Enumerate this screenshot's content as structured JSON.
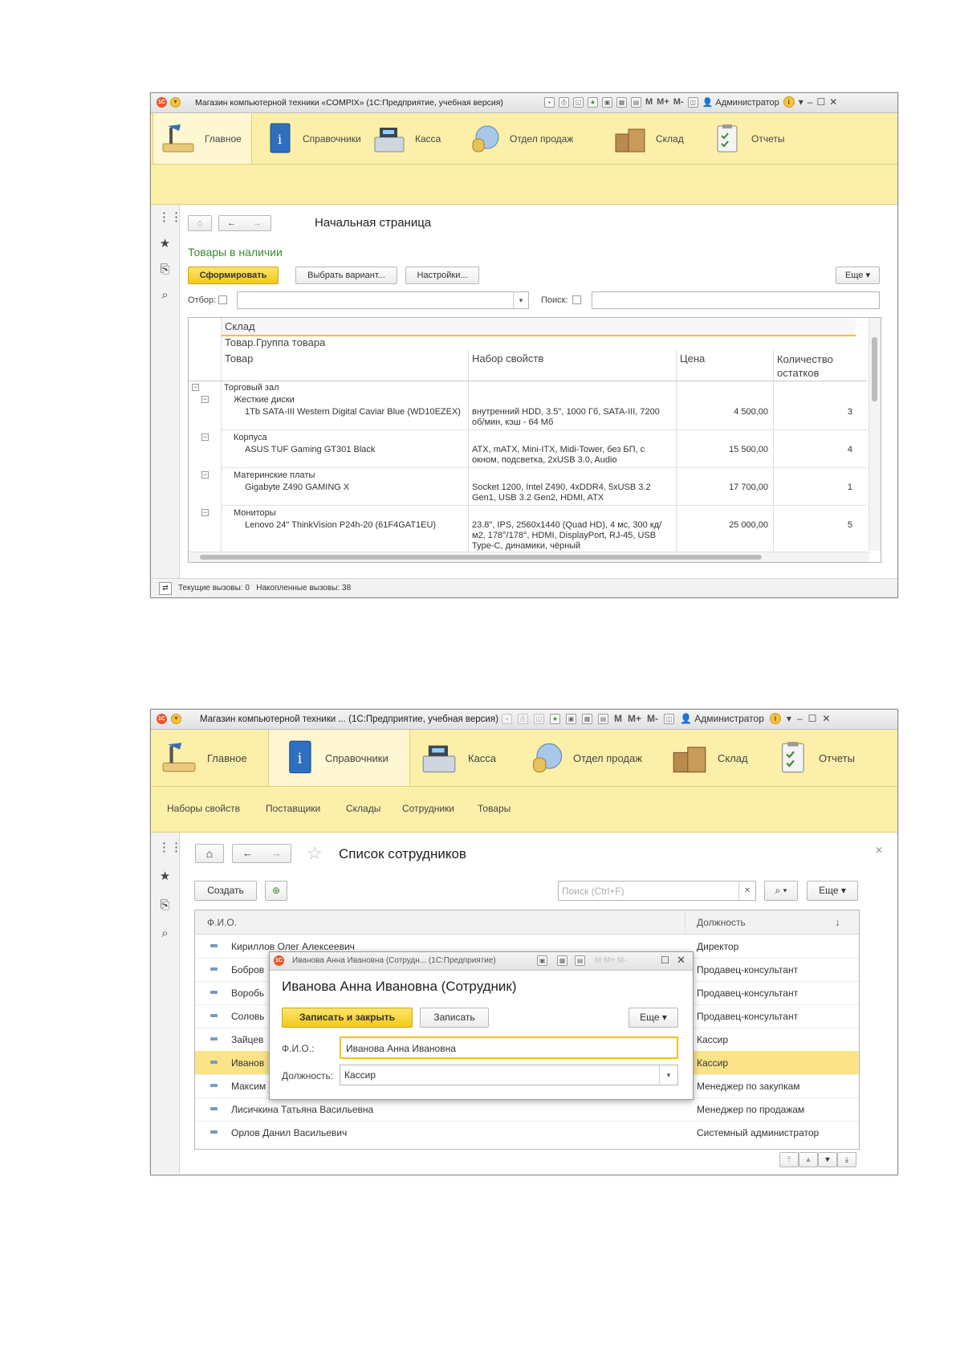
{
  "window1": {
    "title": "Магазин компьютерной техники «COMPIX» (1С:Предприятие, учебная версия)",
    "title_icons": [
      "save-icon",
      "print-icon",
      "preview-icon",
      "favorite-icon",
      "bookmark-icon",
      "calc-icon",
      "calendar-icon"
    ],
    "memory_buttons": [
      "M",
      "M+",
      "M-"
    ],
    "user": "Администратор",
    "sections": [
      "Главное",
      "Справочники",
      "Касса",
      "Отдел продаж",
      "Склад",
      "Отчеты"
    ],
    "active_section": "Главное",
    "page_title": "Начальная страница",
    "report_title": "Товары в наличии",
    "buttons": {
      "generate": "Сформировать",
      "choose_variant": "Выбрать вариант...",
      "settings": "Настройки...",
      "more": "Еще"
    },
    "filter_label": "Отбор:",
    "search_label": "Поиск:",
    "report_headers": {
      "row1": "Склад",
      "row2": "Товар.Группа товара",
      "product": "Товар",
      "properties": "Набор свойств",
      "price": "Цена",
      "quantity": "Количество остатков"
    },
    "warehouse": "Торговый зал",
    "groups": [
      {
        "name": "Жесткие диски",
        "item": "1Tb SATA-III Western Digital Caviar Blue (WD10EZEX)",
        "props": "внутренний HDD, 3.5\", 1000 Гб, SATA-III, 7200 об/мин, кэш - 64 Мб",
        "price": "4 500,00",
        "qty": "3"
      },
      {
        "name": "Корпуса",
        "item": "ASUS TUF Gaming GT301 Black",
        "props": "ATX, mATX, Mini-ITX, Midi-Tower, без БП, с окном, подсветка, 2xUSB 3.0, Audio",
        "price": "15 500,00",
        "qty": "4"
      },
      {
        "name": "Материнские платы",
        "item": "Gigabyte Z490 GAMING X",
        "props": "Socket 1200, Intel Z490, 4xDDR4, 5xUSB 3.2 Gen1, USB 3.2 Gen2, HDMI, ATX",
        "price": "17 700,00",
        "qty": "1"
      },
      {
        "name": "Мониторы",
        "item": "Lenovo 24\" ThinkVision P24h-20 (61F4GAT1EU)",
        "props": "23.8\", IPS, 2560x1440 (Quad HD), 4 мс, 300 кд/м2, 178°/178°, HDMI, DisplayPort, RJ-45, USB Type-C, динамики, чёрный",
        "price": "25 000,00",
        "qty": "5"
      }
    ],
    "status": "Текущие вызовы: 0   Накопленные вызовы: 38"
  },
  "window2": {
    "title": "Магазин компьютерной техники ... (1С:Предприятие, учебная версия)",
    "memory_buttons": [
      "M",
      "M+",
      "M-"
    ],
    "user": "Администратор",
    "sections": [
      "Главное",
      "Справочники",
      "Касса",
      "Отдел продаж",
      "Склад",
      "Отчеты"
    ],
    "active_section": "Справочники",
    "subsections": [
      "Наборы свойств",
      "Поставщики",
      "Склады",
      "Сотрудники",
      "Товары"
    ],
    "page_title": "Список сотрудников",
    "buttons": {
      "create": "Создать",
      "more": "Еще"
    },
    "search_placeholder": "Поиск (Ctrl+F)",
    "columns": {
      "name": "Ф.И.О.",
      "position": "Должность",
      "sort": "↓"
    },
    "rows": [
      {
        "name": "Кириллов Олег Алексеевич",
        "position": "Директор"
      },
      {
        "name": "Бобров",
        "position": "Продавец-консультант"
      },
      {
        "name": "Воробь",
        "position": "Продавец-консультант"
      },
      {
        "name": "Соловь",
        "position": "Продавец-консультант"
      },
      {
        "name": "Зайцев",
        "position": "Кассир"
      },
      {
        "name": "Иванов",
        "position": "Кассир"
      },
      {
        "name": "Максим",
        "position": "Менеджер по закупкам"
      },
      {
        "name": "Лисичкина Татьяна Васильевна",
        "position": "Менеджер по продажам"
      },
      {
        "name": "Орлов Данил Васильевич",
        "position": "Системный администратор"
      }
    ],
    "selected_row": 5,
    "dialog": {
      "title": "Иванова Анна Ивановна (Сотрудн... (1С:Предприятие)",
      "heading": "Иванова Анна Ивановна (Сотрудник)",
      "save_close": "Записать и закрыть",
      "save": "Записать",
      "more": "Еще",
      "fio_label": "Ф.И.О.:",
      "fio_value": "Иванова Анна Ивановна",
      "position_label": "Должность:",
      "position_value": "Кассир"
    }
  },
  "colors": {
    "section_bar": "#fcefa9",
    "default_button": "#f3c919",
    "report_title": "#3a8a3a",
    "selection": "#fbe38a"
  }
}
